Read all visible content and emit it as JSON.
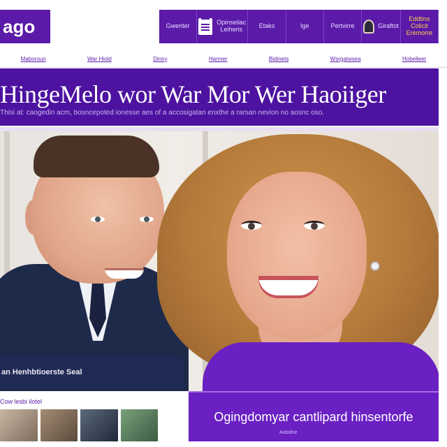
{
  "brand": {
    "logo_text": "ago",
    "accent": "#5b1aa8",
    "promo_color": "#6a20c2"
  },
  "topnav": {
    "items": [
      {
        "label": "Gweriter"
      },
      {
        "label": "Opinseliac Leiheris",
        "icon": "document-icon"
      },
      {
        "label": "Etaks"
      },
      {
        "label": "Ige"
      },
      {
        "label": "Pertvirre"
      },
      {
        "label": "Giraftot",
        "icon": "avatar-icon"
      },
      {
        "label": "Eddtins Colicit Eremorre"
      }
    ]
  },
  "subnav": {
    "items": [
      "Maboroun",
      "War Hiold",
      "Dinny",
      "Harmer",
      "Bidinets",
      "Wsrgatwsea",
      "Hobelleer"
    ]
  },
  "headline": {
    "title": "HingeMelo wor War Mor Wer Haoiiger",
    "subtitle": "Thisi at: caogedin acm, bosncepoted ionesse aes of a accosigatan enxthe a rarsan nevion no aosnc oso."
  },
  "photo": {
    "caption": "an Henhbtioerste Seal"
  },
  "promo": {
    "text": "Ogingdomyar cantlipard hinsentorfe",
    "sub": "Aobidne"
  },
  "related": {
    "label": "Cow lesbi ilotel"
  }
}
